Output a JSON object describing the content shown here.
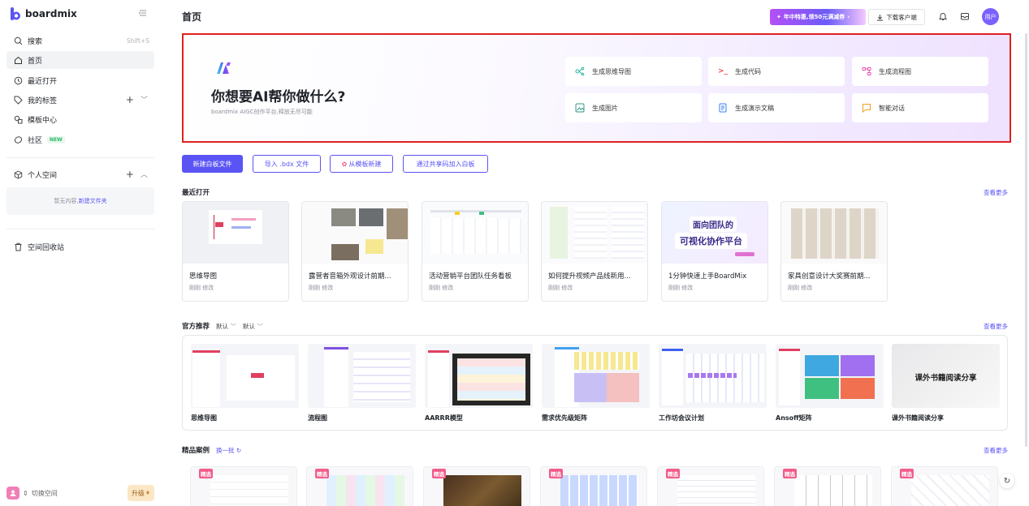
{
  "sidebar": {
    "brand": "boardmix",
    "search": {
      "label": "搜索",
      "shortcut": "Shift+S"
    },
    "items": [
      {
        "label": "首页"
      },
      {
        "label": "最近打开"
      },
      {
        "label": "我的标签"
      },
      {
        "label": "模板中心"
      },
      {
        "label": "社区",
        "badge": "NEW"
      }
    ],
    "personal_space": {
      "label": "个人空间",
      "empty_text": "暂无内容,",
      "empty_link": "新建文件夹"
    },
    "trash": "空间回收站",
    "switch_space": "切换空间",
    "upgrade": "升级"
  },
  "header": {
    "title": "首页",
    "promo": "年中特惠,领50元满减券",
    "download": "下载客户端",
    "user": "用户"
  },
  "hero": {
    "title": "你想要AI帮你做什么?",
    "subtitle": "boardmix AIGC创作平台,释放无尽可能",
    "actions": [
      {
        "label": "生成思维导图",
        "icon": "mindmap-icon"
      },
      {
        "label": "生成代码",
        "icon": "code-icon"
      },
      {
        "label": "生成流程图",
        "icon": "flowchart-icon"
      },
      {
        "label": "生成图片",
        "icon": "image-icon"
      },
      {
        "label": "生成演示文稿",
        "icon": "slides-icon"
      },
      {
        "label": "智能对话",
        "icon": "chat-icon"
      }
    ]
  },
  "actions": {
    "new_board": "新建白板文件",
    "import": "导入 .bdx 文件",
    "from_template": "从模板新建",
    "join_by_code": "通过共享码加入白板"
  },
  "recent": {
    "title": "最近打开",
    "more": "查看更多",
    "cards": [
      {
        "name": "思维导图",
        "time": "刚刚 修改"
      },
      {
        "name": "露营者音箱外观设计前期...",
        "time": "刚刚 修改"
      },
      {
        "name": "活动营销平台团队任务看板",
        "time": "刚刚 修改"
      },
      {
        "name": "如何提升视频产品线新用...",
        "time": "刚刚 修改"
      },
      {
        "name": "1分钟快速上手BoardMix",
        "time": "刚刚 修改",
        "thumb_line1": "面向团队的",
        "thumb_line2": "可视化协作平台"
      },
      {
        "name": "家具创意设计大奖赛前期...",
        "time": "刚刚 修改"
      }
    ]
  },
  "templates": {
    "title": "官方推荐",
    "filter1": "默认",
    "filter2": "默认",
    "more": "查看更多",
    "cards": [
      {
        "name": "思维导图"
      },
      {
        "name": "流程图"
      },
      {
        "name": "AARRR模型"
      },
      {
        "name": "需求优先级矩阵"
      },
      {
        "name": "工作坊会议计划"
      },
      {
        "name": "Ansoff矩阵"
      },
      {
        "name": "课外书籍阅读分享",
        "thumb_text": "课外书籍阅读分享"
      }
    ]
  },
  "featured": {
    "title": "精品案例",
    "refresh": "换一批",
    "more": "查看更多",
    "tag": "精选"
  }
}
